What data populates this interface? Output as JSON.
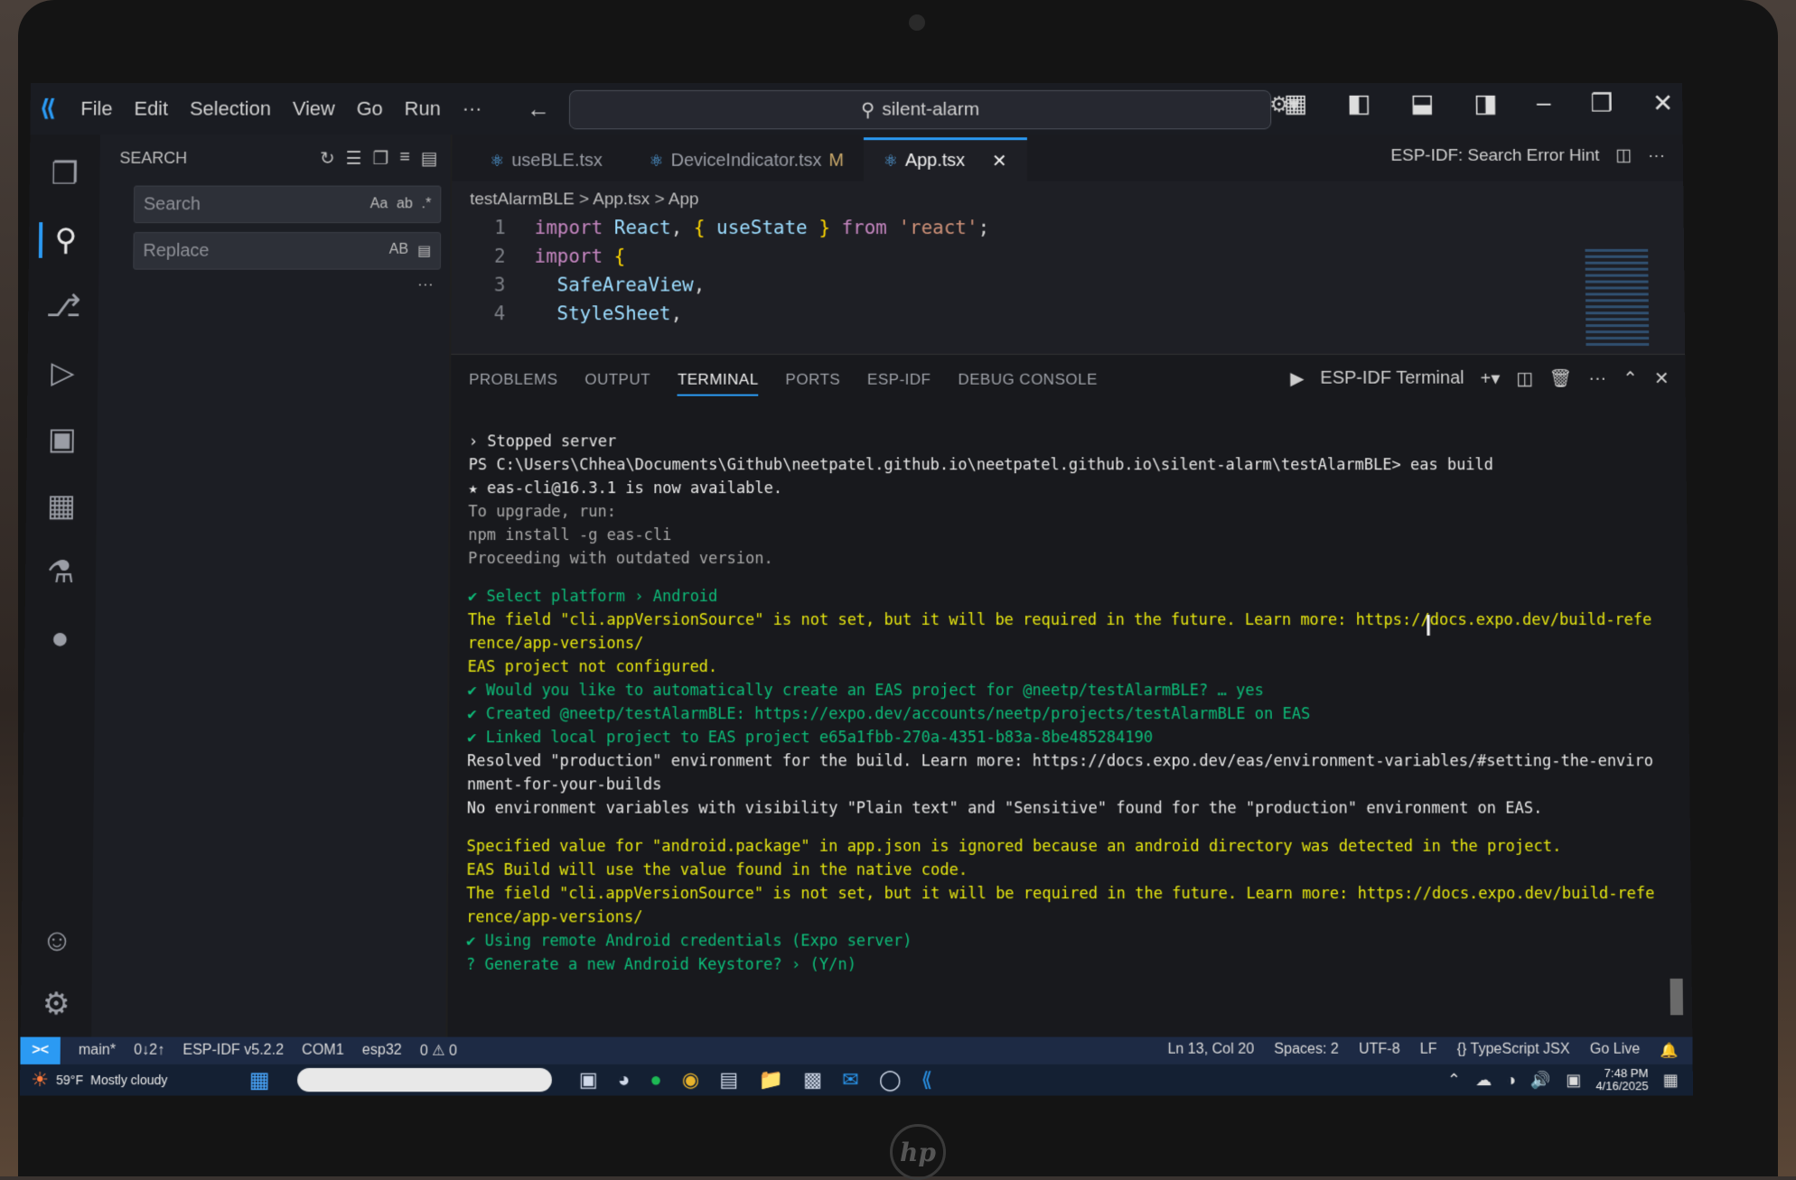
{
  "window": {
    "menu": [
      "File",
      "Edit",
      "Selection",
      "View",
      "Go",
      "Run",
      "···"
    ],
    "command_center": "silent-alarm",
    "accent": "#2b9af3"
  },
  "sidebar": {
    "title": "SEARCH",
    "search_placeholder": "Search",
    "search_opts": "Aa",
    "replace_placeholder": "Replace",
    "replace_opts": "AB"
  },
  "tabs": [
    {
      "label": "useBLE.tsx",
      "modified": ""
    },
    {
      "label": "DeviceIndicator.tsx",
      "modified": "M"
    },
    {
      "label": "App.tsx",
      "modified": ""
    }
  ],
  "editor_hint": "ESP-IDF: Search Error Hint",
  "breadcrumb": "testAlarmBLE > App.tsx > App",
  "code": [
    {
      "ln": "1",
      "parts": [
        [
          "kw",
          "import "
        ],
        [
          "id",
          "React"
        ],
        [
          "tx",
          ", "
        ],
        [
          "br",
          "{ "
        ],
        [
          "id",
          "useState"
        ],
        [
          "br",
          " }"
        ],
        [
          "kw",
          " from "
        ],
        [
          "str",
          "'react'"
        ],
        [
          "tx",
          ";"
        ]
      ]
    },
    {
      "ln": "2",
      "parts": [
        [
          "kw",
          "import "
        ],
        [
          "br",
          "{"
        ]
      ]
    },
    {
      "ln": "3",
      "parts": [
        [
          "tx",
          "  "
        ],
        [
          "id",
          "SafeAreaView"
        ],
        [
          "tx",
          ","
        ]
      ]
    },
    {
      "ln": "4",
      "parts": [
        [
          "tx",
          "  "
        ],
        [
          "id",
          "StyleSheet"
        ],
        [
          "tx",
          ","
        ]
      ]
    }
  ],
  "panel": {
    "tabs": [
      "PROBLEMS",
      "OUTPUT",
      "TERMINAL",
      "PORTS",
      "ESP-IDF",
      "DEBUG CONSOLE"
    ],
    "active_tab": "TERMINAL",
    "terminal_name": "ESP-IDF Terminal"
  },
  "terminal_lines": [
    {
      "c": "",
      "t": "› Stopped server"
    },
    {
      "c": "",
      "t": "PS C:\\Users\\Chhea\\Documents\\Github\\neetpatel.github.io\\neetpatel.github.io\\silent-alarm\\testAlarmBLE> eas build"
    },
    {
      "c": "",
      "t": "★ eas-cli@16.3.1 is now available."
    },
    {
      "c": "dim",
      "t": "To upgrade, run:"
    },
    {
      "c": "dim",
      "t": "npm install -g eas-cli"
    },
    {
      "c": "dim",
      "t": "Proceeding with outdated version."
    },
    {
      "c": "gap",
      "t": ""
    },
    {
      "c": "g",
      "t": "✔ Select platform › Android"
    },
    {
      "c": "y",
      "t": "The field \"cli.appVersionSource\" is not set, but it will be required in the future. Learn more: https://docs.expo.dev/build-refe"
    },
    {
      "c": "y",
      "t": "rence/app-versions/"
    },
    {
      "c": "y",
      "t": "EAS project not configured."
    },
    {
      "c": "g",
      "t": "✔ Would you like to automatically create an EAS project for @neetp/testAlarmBLE? … yes"
    },
    {
      "c": "g",
      "t": "✔ Created @neetp/testAlarmBLE: https://expo.dev/accounts/neetp/projects/testAlarmBLE on EAS"
    },
    {
      "c": "g",
      "t": "✔ Linked local project to EAS project e65a1fbb-270a-4351-b83a-8be485284190"
    },
    {
      "c": "",
      "t": "Resolved \"production\" environment for the build. Learn more: https://docs.expo.dev/eas/environment-variables/#setting-the-enviro"
    },
    {
      "c": "",
      "t": "nment-for-your-builds"
    },
    {
      "c": "",
      "t": "No environment variables with visibility \"Plain text\" and \"Sensitive\" found for the \"production\" environment on EAS."
    },
    {
      "c": "gap",
      "t": ""
    },
    {
      "c": "y",
      "t": "Specified value for \"android.package\" in app.json is ignored because an android directory was detected in the project."
    },
    {
      "c": "y",
      "t": "EAS Build will use the value found in the native code."
    },
    {
      "c": "y",
      "t": "The field \"cli.appVersionSource\" is not set, but it will be required in the future. Learn more: https://docs.expo.dev/build-refe"
    },
    {
      "c": "y",
      "t": "rence/app-versions/"
    },
    {
      "c": "g",
      "t": "✔ Using remote Android credentials (Expo server)"
    },
    {
      "c": "g",
      "t": "? Generate a new Android Keystore? › (Y/n)"
    }
  ],
  "status": {
    "branch": "main*",
    "sync": "0↓2↑",
    "esp_idf": "ESP-IDF v5.2.2",
    "port": "COM1",
    "target": "esp32",
    "problems": "0 ⚠ 0",
    "position": "Ln 13, Col 20",
    "spaces": "Spaces: 2",
    "encoding": "UTF-8",
    "eol": "LF",
    "language": "{} TypeScript JSX",
    "golive": "Go Live"
  },
  "taskbar": {
    "temp": "59°F",
    "weather": "Mostly cloudy",
    "time": "7:48 PM",
    "date": "4/16/2025"
  }
}
